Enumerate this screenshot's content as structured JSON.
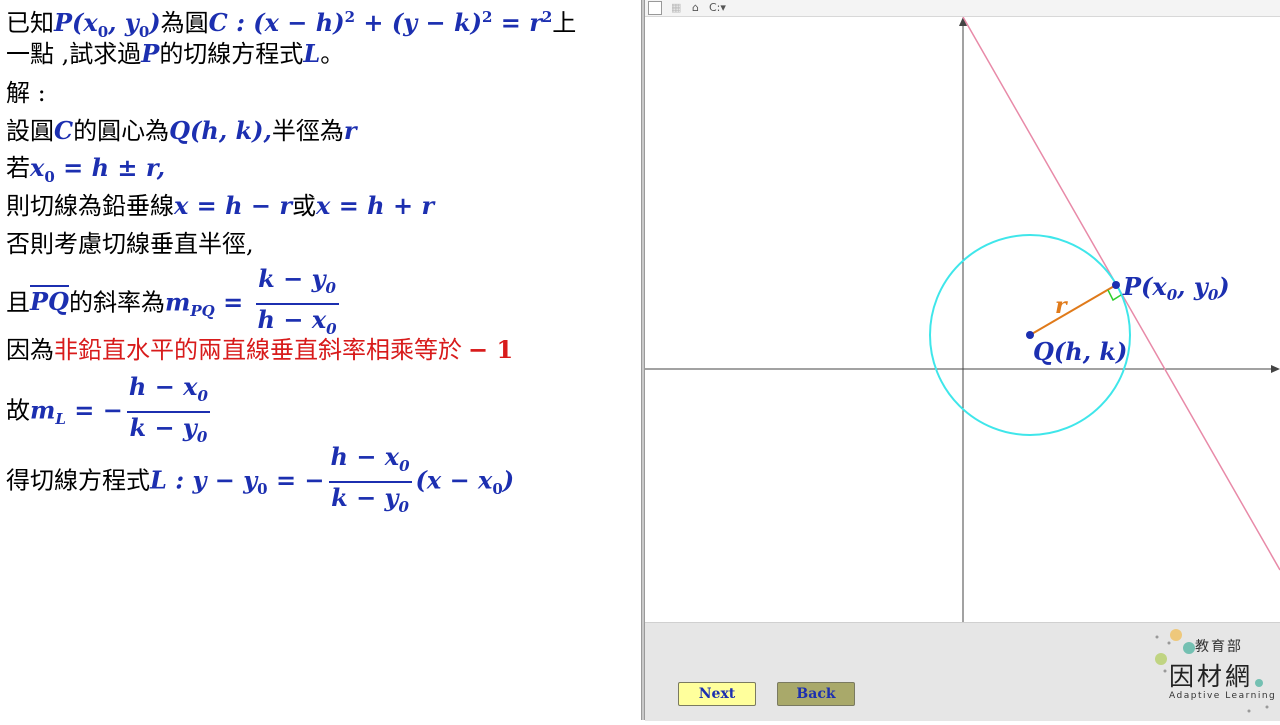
{
  "text": {
    "l1": {
      "a": "已知",
      "b": "P(x",
      "c": "0",
      "d": ", y",
      "e": "0",
      "f": ")",
      "g": "為圓",
      "h": "C : (x − h)",
      "i": "2",
      "j": " + (y − k)",
      "k": "2",
      "l": " = r",
      "m": "2",
      "n": "上"
    },
    "l2": {
      "a": "一點 ,試求過",
      "b": "P",
      "c": "的切線方程式",
      "d": "L",
      "e": "。"
    },
    "l3": {
      "a": "解 :"
    },
    "l4": {
      "a": "設圓",
      "b": "C",
      "c": "的圓心為",
      "d": "Q(h, k),",
      "e": "半徑為",
      "f": "r"
    },
    "l5": {
      "a": "若",
      "b": "x",
      "c": "0",
      "d": " = h ± r,"
    },
    "l6": {
      "a": "則切線為鉛垂線",
      "b": "x = h − r",
      "c": "或",
      "d": "x = h + r"
    },
    "l7": {
      "a": "否則考慮切線垂直半徑,"
    },
    "l8": {
      "a": "且",
      "b": "PQ",
      "c": "的斜率為",
      "d": "m",
      "e": "PQ",
      "f": " = ",
      "num": "k − y",
      "num_sub": "0",
      "den": "h − x",
      "den_sub": "0"
    },
    "l9": {
      "a": "因為",
      "b": "非鉛直水平的兩直線垂直斜率相乘等於",
      "c": "− 1"
    },
    "l10": {
      "a": "故",
      "b": "m",
      "c": "L",
      "d": " = −",
      "num": "h − x",
      "num_sub": "0",
      "den": "k − y",
      "den_sub": "0"
    },
    "l11": {
      "a": "得切線方程式",
      "b": "L",
      "c": " : y − y",
      "d": "0",
      "e": " = −",
      "num": "h − x",
      "num_sub": "0",
      "den": "k − y",
      "den_sub": "0",
      "f": "(x − x",
      "g": "0",
      "h": ")"
    }
  },
  "graph": {
    "label_P": "P(x",
    "label_P_sub": "0",
    "label_P_mid": ", y",
    "label_P_sub2": "0",
    "label_P_end": ")",
    "label_Q": "Q(h, k)",
    "label_r": "r"
  },
  "toolbar": {
    "icons": [
      "page-icon",
      "grid-icon",
      "home-icon",
      "redo-icon"
    ],
    "redo_label": "C:"
  },
  "buttons": {
    "next": "Next",
    "back": "Back"
  },
  "logo": {
    "top": "教育部",
    "main": "因材網",
    "sub": "Adaptive Learning"
  },
  "colors": {
    "math_blue": "#1c2fb0",
    "emphasis_red": "#d81b1b",
    "circle": "#3fe6ea",
    "tangent": "#e88aa8",
    "radius": "#e07a1a",
    "right_angle": "#2fcf2f",
    "next_button": "#ffff9c",
    "back_button": "#a9a96a"
  }
}
